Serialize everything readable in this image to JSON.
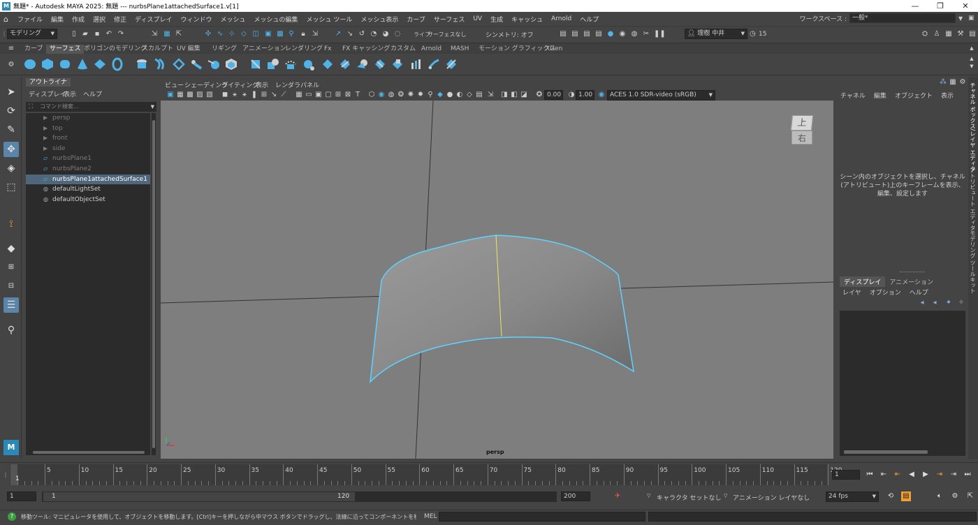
{
  "titlebar": {
    "title": "無題* - Autodesk MAYA 2025: 無題   ---   nurbsPlane1attachedSurface1.v[1]",
    "logo": "M",
    "minimize": "—",
    "restore": "❐",
    "close": "✕"
  },
  "menubar": {
    "items": [
      "ファイル",
      "編集",
      "作成",
      "選択",
      "修正",
      "ディスプレイ",
      "ウィンドウ",
      "メッシュ",
      "メッシュの編集",
      "メッシュ ツール",
      "メッシュ表示",
      "カーブ",
      "サーフェス",
      "UV",
      "生成",
      "キャッシュ",
      "Arnold",
      "ヘルプ"
    ],
    "workspace_label": "ワークスペース :",
    "workspace_value": "一般*"
  },
  "statusline": {
    "menuset": "モデリング",
    "live_label": "ライブ",
    "live_value": "サーフェスなし",
    "symmetry": "シンメトリ: オフ",
    "user": "理樹 中井",
    "credits": "15"
  },
  "shelf": {
    "tabs": [
      "カーブ",
      "サーフェス",
      "ポリゴンのモデリング",
      "スカルプト",
      "UV 編集",
      "リギング",
      "アニメーション",
      "レンダリング",
      "Fx",
      "FX キャッシング",
      "カスタム",
      "Arnold",
      "MASH",
      "モーション グラフィックス",
      "XGen"
    ],
    "active_tab": "サーフェス"
  },
  "outliner": {
    "tab": "アウトライナ",
    "menu": [
      "ディスプレイ",
      "表示",
      "ヘルプ"
    ],
    "search_placeholder": "コマンド検索...",
    "rows": [
      {
        "label": "persp",
        "type": "camera",
        "dim": true
      },
      {
        "label": "top",
        "type": "camera",
        "dim": true
      },
      {
        "label": "front",
        "type": "camera",
        "dim": true
      },
      {
        "label": "side",
        "type": "camera",
        "dim": true
      },
      {
        "label": "nurbsPlane1",
        "type": "surface",
        "dim": true
      },
      {
        "label": "nurbsPlane2",
        "type": "surface",
        "dim": true
      },
      {
        "label": "nurbsPlane1attachedSurface1",
        "type": "surface",
        "dim": false,
        "selected": true
      },
      {
        "label": "defaultLightSet",
        "type": "set",
        "dim": false
      },
      {
        "label": "defaultObjectSet",
        "type": "set",
        "dim": false
      }
    ]
  },
  "viewport": {
    "menu": [
      "ビュー",
      "シェーディング",
      "ライティング",
      "表示",
      "レンダラ",
      "パネル"
    ],
    "exposure": "0.00",
    "gamma": "1.00",
    "colorspace": "ACES 1.0 SDR-video (sRGB)",
    "camera_label": "persp",
    "viewcube_top": "上",
    "viewcube_front": "右",
    "bg_color": "#7e7e7e",
    "highlight_color": "#5fd3ff"
  },
  "channelbox": {
    "menu": [
      "チャネル",
      "編集",
      "オブジェクト",
      "表示"
    ],
    "hint_line1": "シーン内のオブジェクトを選択し、チャネル",
    "hint_line2": "(アトリビュート)上のキーフレームを表示、",
    "hint_line3": "編集、設定します",
    "layer_tabs": [
      "ディスプレイ",
      "アニメーション"
    ],
    "layer_menu": [
      "レイヤ",
      "オプション",
      "ヘルプ"
    ]
  },
  "sidetabs": [
    "チャネル ボックス/レイヤ エディタ",
    "アトリビュート エディタ",
    "モデリング ツールキット"
  ],
  "timeline": {
    "ticks": [
      5,
      10,
      15,
      20,
      25,
      30,
      35,
      40,
      45,
      50,
      55,
      60,
      65,
      70,
      75,
      80,
      85,
      90,
      95,
      100,
      105,
      110,
      115,
      120
    ],
    "start_marker": "1",
    "current_frame": "1",
    "range_start": "1",
    "range_inner_start": "1",
    "range_inner_end": "120",
    "range_end": "200",
    "character_set": "キャラクタ セットなし",
    "anim_layer": "アニメーション レイヤなし",
    "fps": "24 fps"
  },
  "cmdline": {
    "help_text": "移動ツール: マニピュレータを使用して、オブジェクトを移動します。[Ctrl]キーを押しながら中マウス ボタンでドラッグし、法線に沿ってコンポーネントを移動します。[Shift]キーを押しながらマニピ",
    "mel_label": "MEL"
  }
}
